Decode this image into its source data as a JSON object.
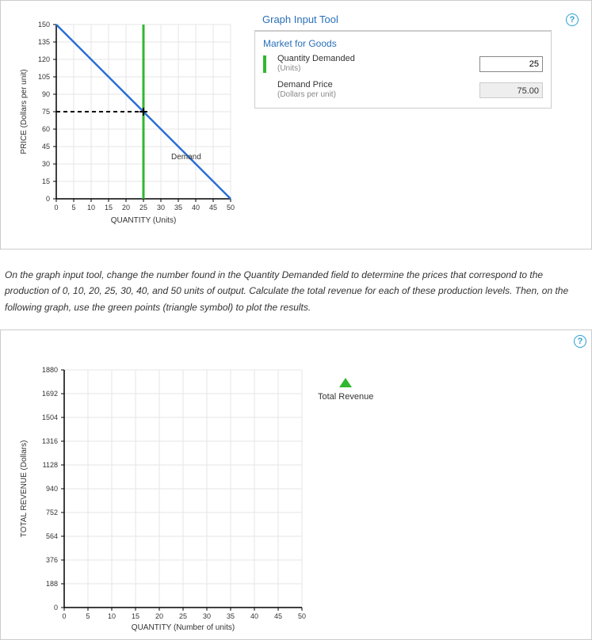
{
  "tool": {
    "title": "Graph Input Tool",
    "subtitle": "Market for Goods",
    "qd_label": "Quantity Demanded",
    "qd_sub": "(Units)",
    "qd_value": "25",
    "price_label": "Demand Price",
    "price_sub": "(Dollars per unit)",
    "price_value": "75.00"
  },
  "help_glyph": "?",
  "chart_data": [
    {
      "type": "line",
      "title": "",
      "xlabel": "QUANTITY (Units)",
      "ylabel": "PRICE (Dollars per unit)",
      "xlim": [
        0,
        50
      ],
      "ylim": [
        0,
        150
      ],
      "xticks": [
        0,
        5,
        10,
        15,
        20,
        25,
        30,
        35,
        40,
        45,
        50
      ],
      "yticks": [
        0,
        15,
        30,
        45,
        60,
        75,
        90,
        105,
        120,
        135,
        150
      ],
      "series": [
        {
          "name": "Demand",
          "color": "#2a6fd6",
          "x": [
            0,
            50
          ],
          "y": [
            150,
            0
          ]
        }
      ],
      "guides": {
        "vline_x": 25,
        "vline_color": "#2fb82f",
        "hline_y": 75,
        "hline_xmax": 25,
        "hline_style": "dashed",
        "marker": {
          "x": 25,
          "y": 75,
          "symbol": "plus"
        }
      },
      "annotations": [
        {
          "text": "Demand",
          "x": 30,
          "y": 35
        }
      ]
    },
    {
      "type": "scatter",
      "title": "",
      "xlabel": "QUANTITY (Number of units)",
      "ylabel": "TOTAL REVENUE (Dollars)",
      "xlim": [
        0,
        50
      ],
      "ylim": [
        0,
        1880
      ],
      "xticks": [
        0,
        5,
        10,
        15,
        20,
        25,
        30,
        35,
        40,
        45,
        50
      ],
      "yticks": [
        0,
        188,
        376,
        564,
        752,
        940,
        1128,
        1316,
        1504,
        1692,
        1880
      ],
      "series": [],
      "legend": {
        "items": [
          "Total Revenue"
        ],
        "symbol": "triangle",
        "color": "#2fb82f"
      }
    }
  ],
  "instructions": "On the graph input tool, change the number found in the Quantity Demanded field to determine the prices that correspond to the production of 0, 10, 20, 25, 30, 40, and 50 units of output. Calculate the total revenue for each of these production levels. Then, on the following graph, use the green points (triangle symbol) to plot the results.",
  "legend_label": "Total Revenue"
}
